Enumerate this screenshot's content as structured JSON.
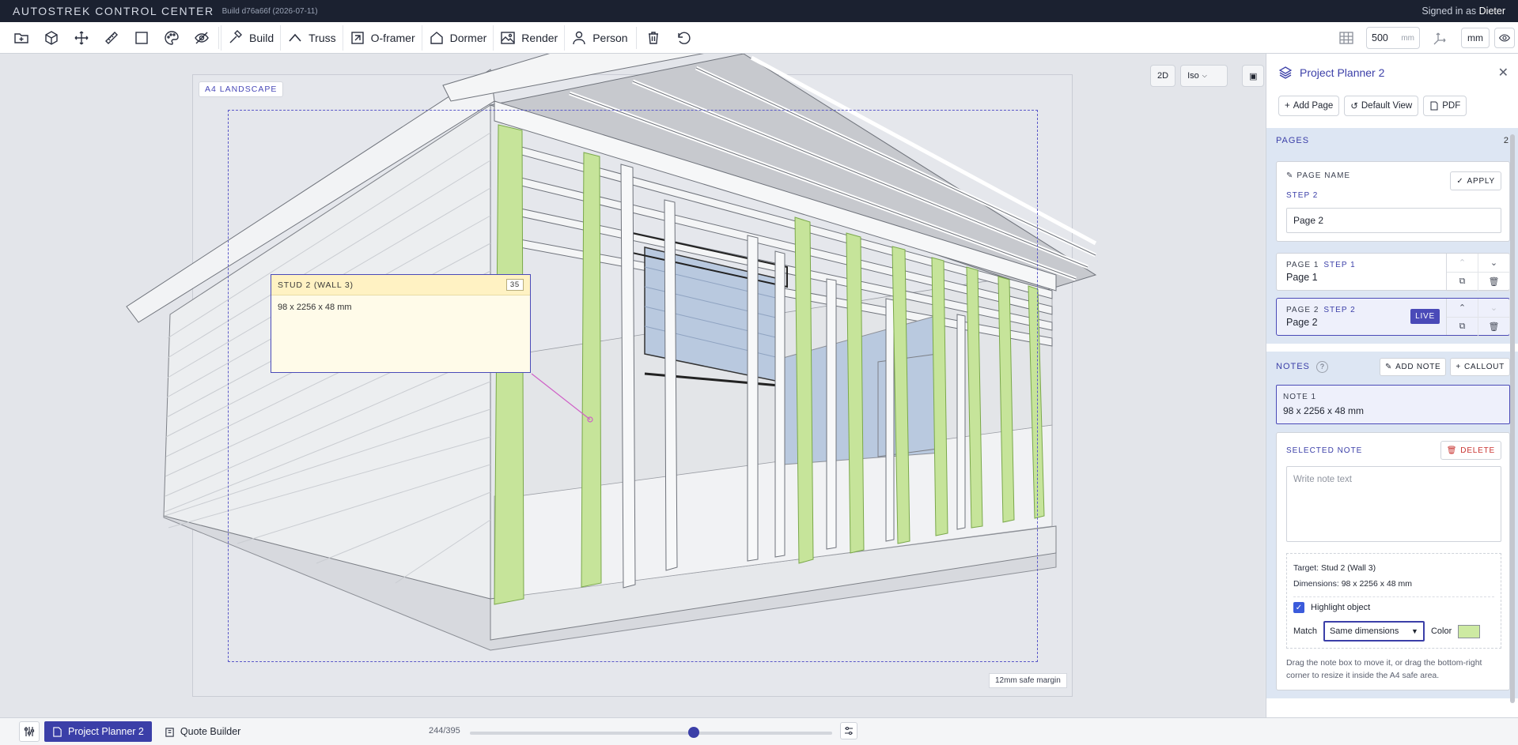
{
  "titlebar": {
    "app_name": "AUTOSTREK CONTROL CENTER",
    "build": "Build d76a66f (2026-07-11)",
    "signed_in_prefix": "Signed in as",
    "user": "Dieter"
  },
  "toolbar": {
    "icons": [
      "folder-add-icon",
      "cube-icon",
      "move-icon",
      "ruler-icon",
      "square-icon",
      "palette-icon",
      "hide-icon"
    ],
    "buttons": [
      {
        "label": "Build",
        "icon": "hammer-icon"
      },
      {
        "label": "Truss",
        "icon": "truss-icon"
      },
      {
        "label": "O-framer",
        "icon": "frame-icon"
      },
      {
        "label": "Dormer",
        "icon": "dormer-icon"
      },
      {
        "label": "Render",
        "icon": "image-icon"
      },
      {
        "label": "Person",
        "icon": "person-icon"
      }
    ],
    "grid_value": "500",
    "grid_unit": "mm",
    "unit_button": "mm"
  },
  "canvas": {
    "page_label": "A4 LANDSCAPE",
    "safe_margin_label": "12mm safe margin",
    "view_2d": "2D",
    "view_mode": "Iso"
  },
  "note_overlay": {
    "title": "STUD 2 (WALL 3)",
    "number": "35",
    "body": "98 x 2256 x 48 mm"
  },
  "panel": {
    "title": "Project Planner 2",
    "actions": {
      "add_page": "Add Page",
      "default_view": "Default View",
      "pdf": "PDF"
    },
    "pages_section": "PAGES",
    "pages_count": "2",
    "page_name_label": "PAGE NAME",
    "apply": "APPLY",
    "step_label": "STEP 2",
    "page_name_value": "Page 2",
    "pages": [
      {
        "page": "PAGE 1",
        "step": "STEP 1",
        "name": "Page 1"
      },
      {
        "page": "PAGE 2",
        "step": "STEP 2",
        "name": "Page 2",
        "badge": "LIVE"
      }
    ],
    "notes_section": "NOTES",
    "notes_help": "?",
    "add_note": "ADD NOTE",
    "callout": "CALLOUT",
    "note_item": {
      "title": "NOTE 1",
      "text": "98 x 2256 x 48 mm"
    },
    "selected_note": {
      "title": "SELECTED NOTE",
      "delete": "DELETE",
      "placeholder": "Write note text",
      "target_label": "Target:",
      "target_value": "Stud 2 (Wall 3)",
      "dims_label": "Dimensions:",
      "dims_value": "98 x 2256 x 48 mm",
      "highlight_label": "Highlight object",
      "match_label": "Match",
      "match_value": "Same dimensions",
      "color_label": "Color",
      "color_value": "#cdeaa2",
      "help": "Drag the note box to move it, or drag the bottom-right corner to resize it inside the A4 safe area."
    }
  },
  "bottombar": {
    "tabs": [
      "Project Planner 2",
      "Quote Builder"
    ],
    "slider_label": "244/395",
    "slider_value": 244,
    "slider_max": 395
  }
}
